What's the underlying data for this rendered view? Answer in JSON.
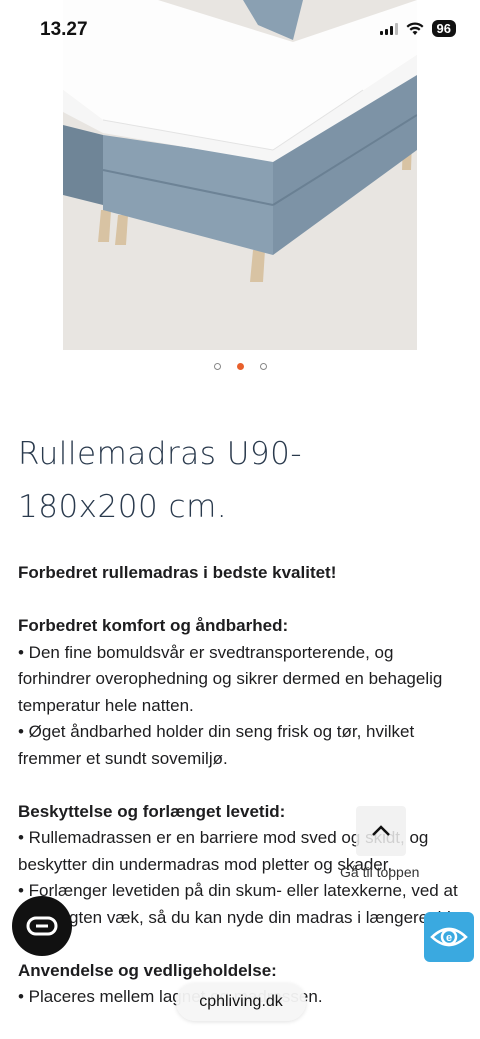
{
  "status_bar": {
    "time": "13.27",
    "battery": "96",
    "icons": [
      "signal-icon",
      "wifi-icon",
      "battery-icon"
    ]
  },
  "carousel": {
    "total": 3,
    "active_index": 1
  },
  "product": {
    "title_line1": "Rullemadras U90-",
    "title_line2": "180x200 cm."
  },
  "description": {
    "intro": "Forbedret rullemadras i bedste kvalitet!",
    "section1": {
      "heading": "Forbedret komfort og åndbarhed:",
      "bullets": [
        "• Den fine bomuldsvår er svedtransporterende, og forhindrer overophedning og sikrer dermed en behagelig temperatur hele natten.",
        "• Øget åndbarhed holder din seng frisk og tør, hvilket fremmer et sundt sovemiljø."
      ]
    },
    "section2": {
      "heading": "Beskyttelse og forlænget levetid:",
      "bullets": [
        "• Rullemadrassen er en barriere mod sved og skidt, og beskytter din undermadras mod pletter og skader.",
        "• Forlænger levetiden på din skum- eller latexkerne, ved at lede fugten væk, så du kan nyde din madras i længere tid."
      ]
    },
    "section3": {
      "heading": "Anvendelse og vedligeholdelse:",
      "bullets": [
        "• Placeres mellem lagnet og madrassen."
      ]
    }
  },
  "back_to_top": {
    "label": "Gå til toppen"
  },
  "browser": {
    "url": "cphliving.dk"
  },
  "colors": {
    "accent": "#e8602c",
    "title": "#2a3a4d",
    "eye_button": "#3aa9e0"
  }
}
